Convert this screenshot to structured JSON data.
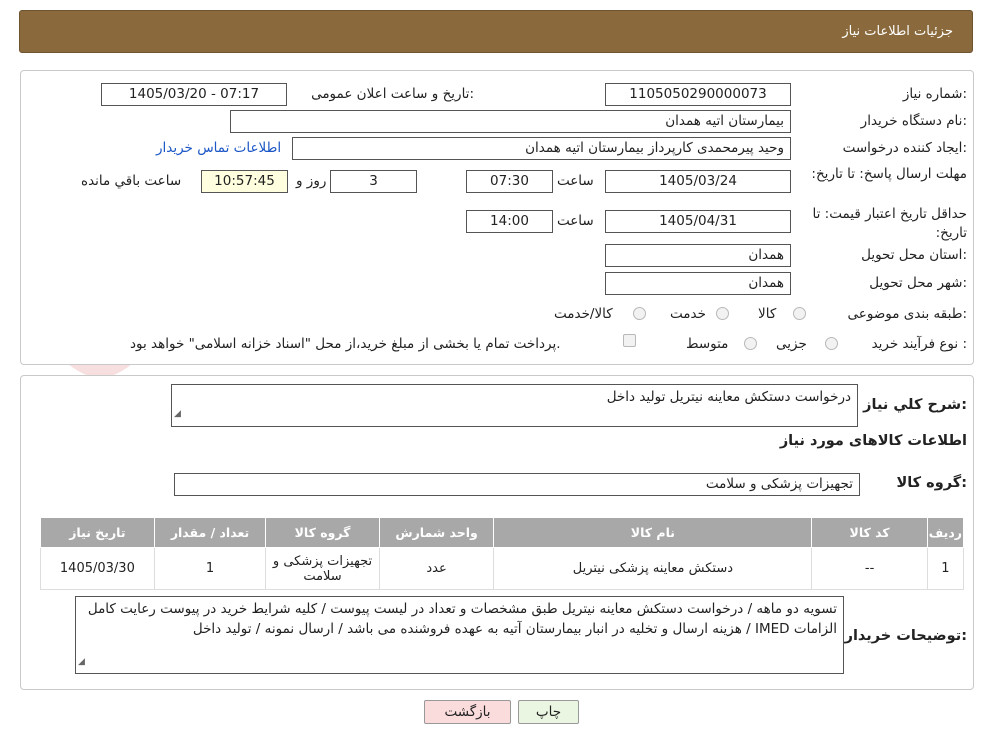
{
  "header": {
    "title": "جزئیات اطلاعات نیاز"
  },
  "form": {
    "need_number_label": "شماره نیاز:",
    "need_number": "1105050290000073",
    "announce_label": "تاریخ و ساعت اعلان عمومی:",
    "announce_value": "1405/03/20 - 07:17",
    "buyer_org_label": "نام دستگاه خریدار:",
    "buyer_org": "بیمارستان اتیه همدان",
    "creator_label": "ایجاد کننده درخواست:",
    "creator": "وحید پیرمحمدی کارپرداز بیمارستان اتیه همدان",
    "contact_link": "اطلاعات تماس خریدار",
    "reply_deadline_label": "مهلت ارسال پاسخ: تا تاریخ:",
    "reply_date": "1405/03/24",
    "time_label": "ساعت",
    "reply_time": "07:30",
    "days_value": "3",
    "days_label": "روز و",
    "remaining_time": "10:57:45",
    "remaining_label": "ساعت باقي مانده",
    "validity_label": "حداقل تاریخ اعتبار قیمت: تا تاریخ:",
    "validity_date": "1405/04/31",
    "validity_time_label": "ساعت",
    "validity_time": "14:00",
    "province_label": "استان محل تحویل:",
    "province": "همدان",
    "city_label": "شهر محل تحویل:",
    "city": "همدان",
    "category_label": "طبقه بندی موضوعی:",
    "category_options": [
      "کالا",
      "خدمت",
      "کالا/خدمت"
    ],
    "process_label": "نوع فرآیند خرید :",
    "process_options": [
      "جزیی",
      "متوسط"
    ],
    "payment_note": "پرداخت تمام یا بخشی از مبلغ خرید،از محل \"اسناد خزانه اسلامی\" خواهد بود."
  },
  "details": {
    "summary_label": "شرح کلي نیاز:",
    "summary": "درخواست دستکش معاینه نیتریل تولید داخل",
    "goods_heading": "اطلاعات کالاهای مورد نیاز",
    "group_label": "گروه کالا:",
    "group_value": "تجهیزات پزشکی و سلامت",
    "table": {
      "headers": [
        "ردیف",
        "کد کالا",
        "نام کالا",
        "واحد شمارش",
        "گروه کالا",
        "تعداد / مقدار",
        "تاریخ نیاز"
      ],
      "rows": [
        [
          "1",
          "--",
          "دستکش معاینه پزشکی نیتریل",
          "عدد",
          "تجهیزات پزشکی و سلامت",
          "1",
          "1405/03/30"
        ]
      ]
    },
    "buyer_notes_label": "توضیحات خریدار:",
    "buyer_notes": "تسویه دو ماهه / درخواست دستکش معاینه نیتریل طبق مشخصات و تعداد در لیست پیوست / کلیه شرایط خرید در پیوست رعایت کامل الزامات IMED / هزینه ارسال و تخلیه در انبار بیمارستان آتیه به عهده فروشنده می باشد / ارسال نمونه / تولید داخل"
  },
  "buttons": {
    "print": "چاپ",
    "back": "بازگشت"
  },
  "watermark": {
    "text": "AriaTender.neT"
  },
  "colors": {
    "header_bg": "#8a6a3c",
    "table_header_bg": "#a8a8a8",
    "back_button_bg": "#fbdcdc",
    "print_button_bg": "#eaf6e1"
  }
}
